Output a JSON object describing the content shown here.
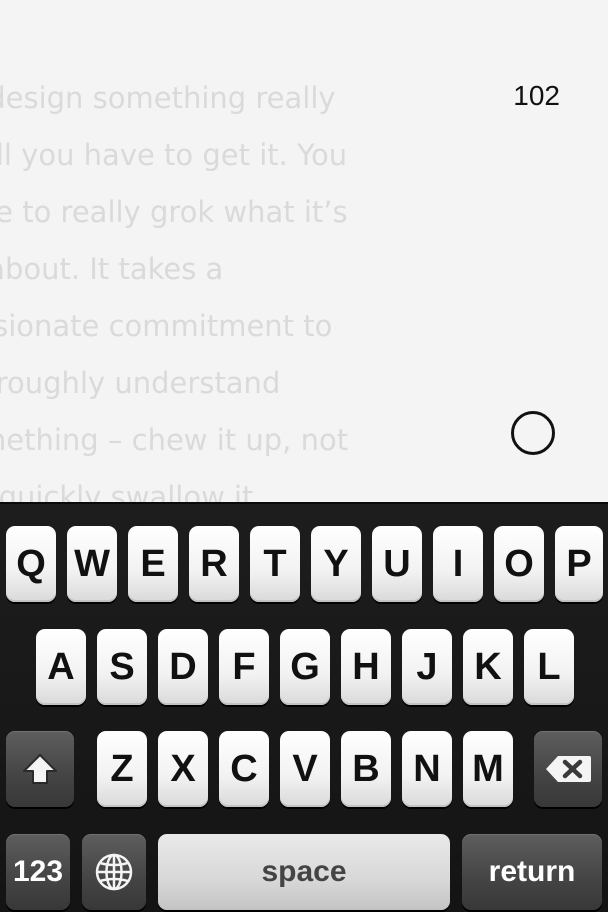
{
  "editor": {
    "text_lines": [
      " design something really",
      "ell you have to get it. You",
      "ve to really grok what it’s",
      " about. It takes a",
      "ssionate commitment to",
      "oroughly understand",
      "mething – chew it up, not",
      "t quickly swallow it."
    ],
    "word_count": "102",
    "focus_toggle_icon": "circle-icon"
  },
  "keyboard": {
    "row1": [
      "Q",
      "W",
      "E",
      "R",
      "T",
      "Y",
      "U",
      "I",
      "O",
      "P"
    ],
    "row2": [
      "A",
      "S",
      "D",
      "F",
      "G",
      "H",
      "J",
      "K",
      "L"
    ],
    "row3": [
      "Z",
      "X",
      "C",
      "V",
      "B",
      "N",
      "M"
    ],
    "shift_icon": "shift-arrow-icon",
    "delete_icon": "backspace-icon",
    "numbers_label": "123",
    "globe_icon": "globe-icon",
    "space_label": "space",
    "return_label": "return"
  },
  "colors": {
    "editor_background": "#f4f4f4",
    "faded_text": "#dadada",
    "keyboard_background": "#1a1a1a",
    "key_light": "#ffffff",
    "key_dark": "#4a4a4a"
  }
}
